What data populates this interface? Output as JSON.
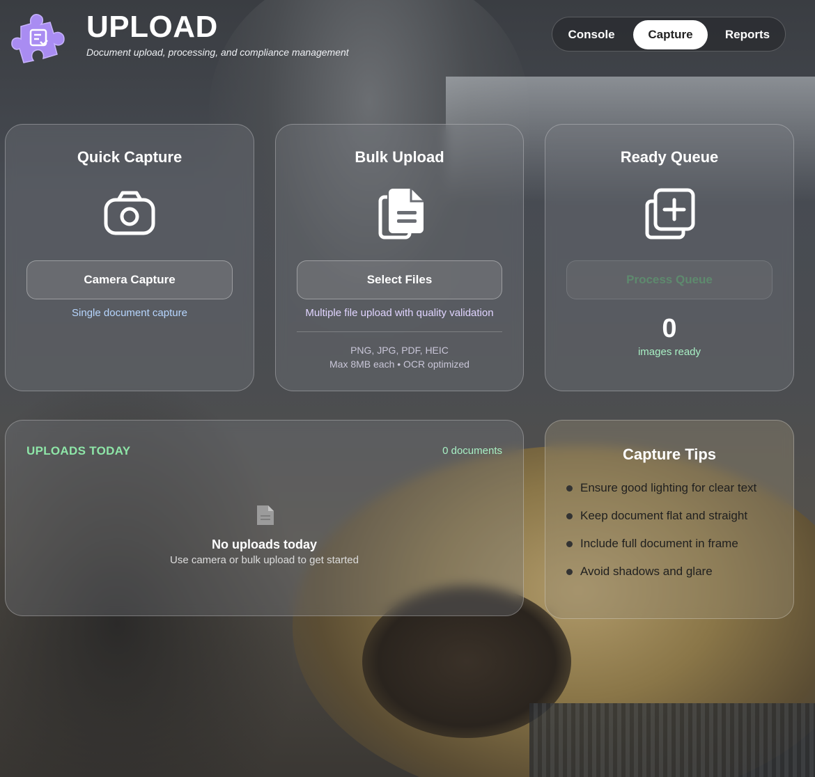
{
  "app": {
    "title": "UPLOAD",
    "subtitle": "Document upload, processing, and compliance management"
  },
  "nav": {
    "tabs": [
      {
        "label": "Console"
      },
      {
        "label": "Capture",
        "active": true
      },
      {
        "label": "Reports"
      }
    ]
  },
  "cards": {
    "quick_capture": {
      "title": "Quick Capture",
      "icon": "camera-icon",
      "button": "Camera Capture",
      "caption": "Single document capture"
    },
    "bulk_upload": {
      "title": "Bulk Upload",
      "icon": "documents-icon",
      "button": "Select Files",
      "caption": "Multiple file upload with quality validation",
      "formats": "PNG, JPG, PDF, HEIC",
      "limits": "Max 8MB each • OCR optimized"
    },
    "ready_queue": {
      "title": "Ready Queue",
      "icon": "add-to-queue-icon",
      "button": "Process Queue",
      "button_disabled": true,
      "count": "0",
      "count_label": "images ready"
    }
  },
  "uploads_today": {
    "title": "UPLOADS TODAY",
    "count": "0 documents",
    "empty_icon": "file-icon",
    "empty_title": "No uploads today",
    "empty_subtitle": "Use camera or bulk upload to get started"
  },
  "capture_tips": {
    "title": "Capture Tips",
    "items": [
      "Ensure good lighting for clear text",
      "Keep document flat and straight",
      "Include full document in frame",
      "Avoid shadows and glare"
    ]
  },
  "colors": {
    "accent_green": "#8ee6a8",
    "caption_blue": "#b7d6ff",
    "caption_purple": "#e0d4ff",
    "logo_purple": "#a98cf2"
  }
}
